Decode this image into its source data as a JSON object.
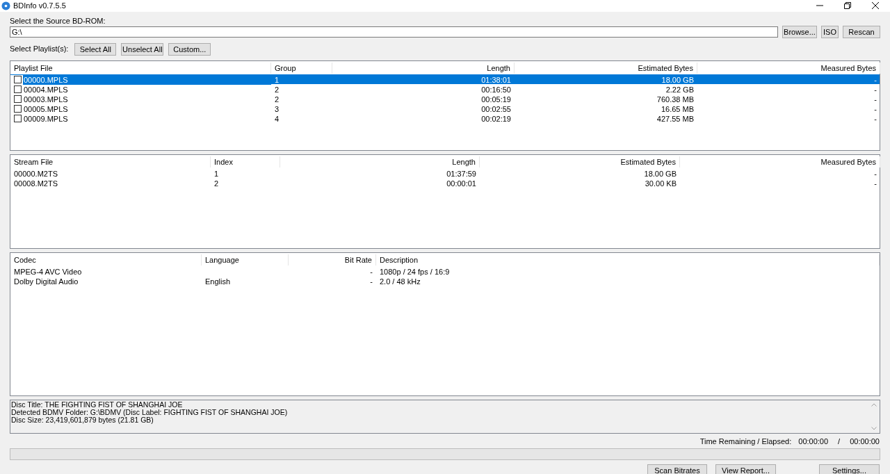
{
  "window": {
    "title": "BDInfo v0.7.5.5"
  },
  "source": {
    "label": "Select the Source BD-ROM:",
    "value": "G:\\",
    "buttons": [
      "Browse...",
      "ISO",
      "Rescan"
    ]
  },
  "playlist_bar": {
    "label": "Select Playlist(s):",
    "buttons": [
      "Select All",
      "Unselect All",
      "Custom..."
    ]
  },
  "playlists": {
    "columns": [
      "Playlist File",
      "Group",
      "Length",
      "Estimated Bytes",
      "Measured Bytes"
    ],
    "rows": [
      {
        "file": "00000.MPLS",
        "group": "1",
        "length": "01:38:01",
        "estimated": "18.00 GB",
        "measured": "-",
        "checked": false,
        "selected": true
      },
      {
        "file": "00004.MPLS",
        "group": "2",
        "length": "00:16:50",
        "estimated": "2.22 GB",
        "measured": "-",
        "checked": false,
        "selected": false
      },
      {
        "file": "00003.MPLS",
        "group": "2",
        "length": "00:05:19",
        "estimated": "760.38 MB",
        "measured": "-",
        "checked": false,
        "selected": false
      },
      {
        "file": "00005.MPLS",
        "group": "3",
        "length": "00:02:55",
        "estimated": "16.65 MB",
        "measured": "-",
        "checked": false,
        "selected": false
      },
      {
        "file": "00009.MPLS",
        "group": "4",
        "length": "00:02:19",
        "estimated": "427.55 MB",
        "measured": "-",
        "checked": false,
        "selected": false
      }
    ]
  },
  "streams": {
    "columns": [
      "Stream File",
      "Index",
      "Length",
      "Estimated Bytes",
      "Measured Bytes"
    ],
    "rows": [
      {
        "file": "00000.M2TS",
        "index": "1",
        "length": "01:37:59",
        "estimated": "18.00 GB",
        "measured": "-"
      },
      {
        "file": "00008.M2TS",
        "index": "2",
        "length": "00:00:01",
        "estimated": "30.00 KB",
        "measured": "-"
      }
    ]
  },
  "codecs": {
    "columns": [
      "Codec",
      "Language",
      "Bit Rate",
      "Description"
    ],
    "rows": [
      {
        "codec": "MPEG-4 AVC Video",
        "language": "",
        "bitrate": "-",
        "description": "1080p / 24 fps / 16:9"
      },
      {
        "codec": "Dolby Digital Audio",
        "language": "English",
        "bitrate": "-",
        "description": "2.0 / 48 kHz"
      }
    ]
  },
  "info": [
    "Disc Title: THE FIGHTING FIST OF SHANGHAI JOE",
    "Detected BDMV Folder: G:\\BDMV (Disc Label: FIGHTING FIST OF SHANGHAI JOE)",
    "Disc Size: 23,419,601,879 bytes (21.81 GB)"
  ],
  "time": {
    "label": "Time Remaining / Elapsed:",
    "remaining": "00:00:00",
    "separator": "/",
    "elapsed": "00:00:00"
  },
  "progress": {
    "level": 0
  },
  "buttons": [
    "Scan Bitrates",
    "View Report...",
    "Settings..."
  ]
}
